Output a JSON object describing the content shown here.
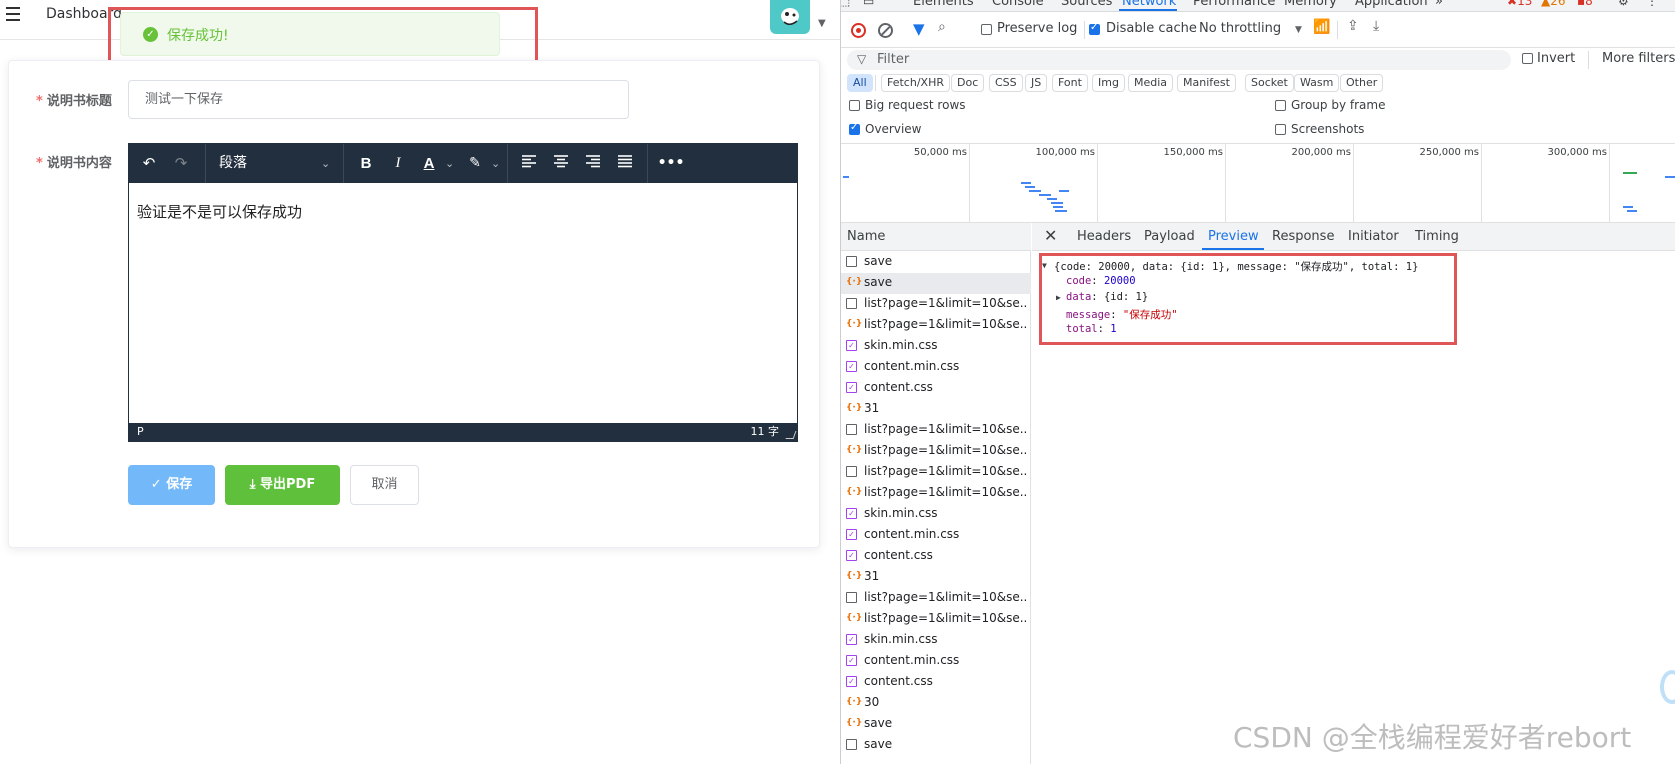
{
  "header": {
    "breadcrumb": "Dashboard"
  },
  "toast": {
    "message": "保存成功!",
    "icon": "success-check-icon"
  },
  "form": {
    "title_label": "说明书标题",
    "title_value": "测试一下保存",
    "content_label": "说明书内容",
    "required_mark": "*",
    "editor": {
      "block_format": "段落",
      "content": "验证是不是可以保存成功",
      "status_path": "P",
      "word_count": "11 字"
    },
    "buttons": {
      "save": "✓ 保存",
      "export_pdf": "⤓ 导出PDF",
      "cancel": "取消"
    }
  },
  "colors": {
    "primary_light": "#73b8f8",
    "success": "#5fc03c",
    "highlight": "#e05656",
    "devtools_accent": "#1a73e8"
  },
  "devtools": {
    "tabs": [
      "Elements",
      "Console",
      "Sources",
      "Network",
      "Performance",
      "Memory",
      "Application",
      "»"
    ],
    "active_tab": "Network",
    "issues": {
      "errors": "13",
      "warnings": "26",
      "info": "8"
    },
    "toolbar": {
      "preserve_log": "Preserve log",
      "disable_cache": "Disable cache",
      "throttling": "No throttling"
    },
    "filter": {
      "placeholder": "Filter",
      "invert": "Invert",
      "more_filters": "More filters"
    },
    "type_filters": [
      "All",
      "Fetch/XHR",
      "Doc",
      "CSS",
      "JS",
      "Font",
      "Img",
      "Media",
      "Manifest",
      "Socket",
      "Wasm",
      "Other"
    ],
    "options": {
      "big_request_rows": "Big request rows",
      "group_by_frame": "Group by frame",
      "overview": "Overview",
      "screenshots": "Screenshots"
    },
    "overview_ticks": [
      "50,000 ms",
      "100,000 ms",
      "150,000 ms",
      "200,000 ms",
      "250,000 ms",
      "300,000 ms"
    ],
    "name_header": "Name",
    "requests": [
      {
        "name": "save",
        "type": "doc"
      },
      {
        "name": "save",
        "type": "xhr"
      },
      {
        "name": "list?page=1&limit=10&se...",
        "type": "doc"
      },
      {
        "name": "list?page=1&limit=10&se...",
        "type": "xhr"
      },
      {
        "name": "skin.min.css",
        "type": "css"
      },
      {
        "name": "content.min.css",
        "type": "css"
      },
      {
        "name": "content.css",
        "type": "css"
      },
      {
        "name": "31",
        "type": "xhr"
      },
      {
        "name": "list?page=1&limit=10&se...",
        "type": "doc"
      },
      {
        "name": "list?page=1&limit=10&se...",
        "type": "xhr"
      },
      {
        "name": "list?page=1&limit=10&se...",
        "type": "doc"
      },
      {
        "name": "list?page=1&limit=10&se...",
        "type": "xhr"
      },
      {
        "name": "skin.min.css",
        "type": "css"
      },
      {
        "name": "content.min.css",
        "type": "css"
      },
      {
        "name": "content.css",
        "type": "css"
      },
      {
        "name": "31",
        "type": "xhr"
      },
      {
        "name": "list?page=1&limit=10&se...",
        "type": "doc"
      },
      {
        "name": "list?page=1&limit=10&se...",
        "type": "xhr"
      },
      {
        "name": "skin.min.css",
        "type": "css"
      },
      {
        "name": "content.min.css",
        "type": "css"
      },
      {
        "name": "content.css",
        "type": "css"
      },
      {
        "name": "30",
        "type": "xhr"
      },
      {
        "name": "save",
        "type": "xhr"
      },
      {
        "name": "save",
        "type": "doc"
      }
    ],
    "detail_tabs": [
      "Headers",
      "Payload",
      "Preview",
      "Response",
      "Initiator",
      "Timing"
    ],
    "active_detail_tab": "Preview",
    "preview": {
      "summary": "{code: 20000, data: {id: 1}, message: \"保存成功\", total: 1}",
      "code_key": "code",
      "code_value": "20000",
      "data_key": "data",
      "data_value": "{id: 1}",
      "message_key": "message",
      "message_value": "\"保存成功\"",
      "total_key": "total",
      "total_value": "1"
    }
  },
  "watermark": "CSDN @全栈编程爱好者rebort"
}
